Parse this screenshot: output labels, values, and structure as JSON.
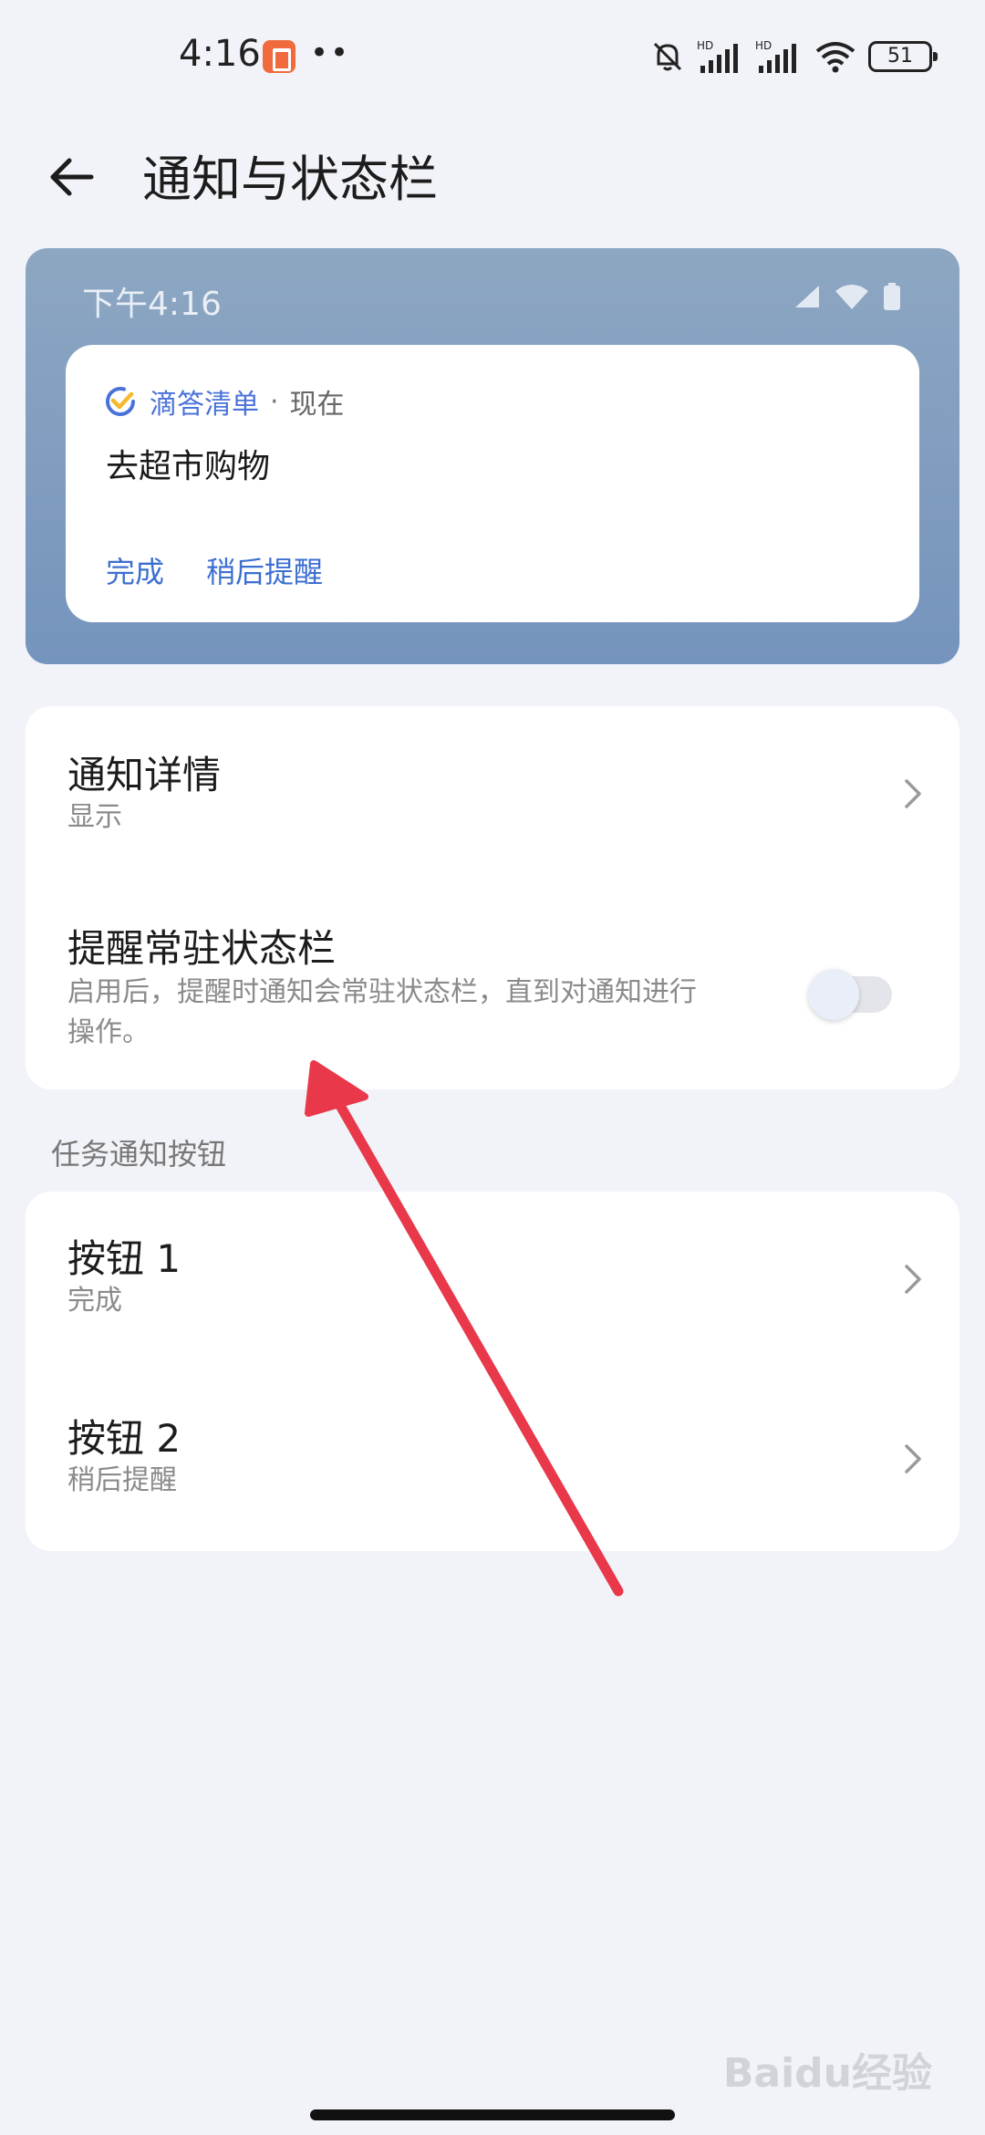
{
  "status_bar": {
    "time": "4:16",
    "dots": "••",
    "battery": "51",
    "signal_label": "HD"
  },
  "header": {
    "title": "通知与状态栏"
  },
  "preview": {
    "time": "下午4:16",
    "notification": {
      "app_name": "滴答清单",
      "separator": "·",
      "when": "现在",
      "text": "去超市购物",
      "action_done": "完成",
      "action_snooze": "稍后提醒"
    }
  },
  "group1": {
    "details": {
      "title": "通知详情",
      "subtitle": "显示"
    },
    "pin": {
      "title": "提醒常驻状态栏",
      "subtitle_line1": "启用后，提醒时通知会常驻状态栏，直到对通知进行",
      "subtitle_line2": "操作。",
      "enabled": false
    }
  },
  "section_label": "任务通知按钮",
  "group2": {
    "button1": {
      "title": "按钮 1",
      "subtitle": "完成"
    },
    "button2": {
      "title": "按钮 2",
      "subtitle": "稍后提醒"
    }
  },
  "watermark": "Baidu经验",
  "colors": {
    "accent": "#3d6fd1",
    "arrow": "#e8384a",
    "background": "#f2f3f8"
  }
}
